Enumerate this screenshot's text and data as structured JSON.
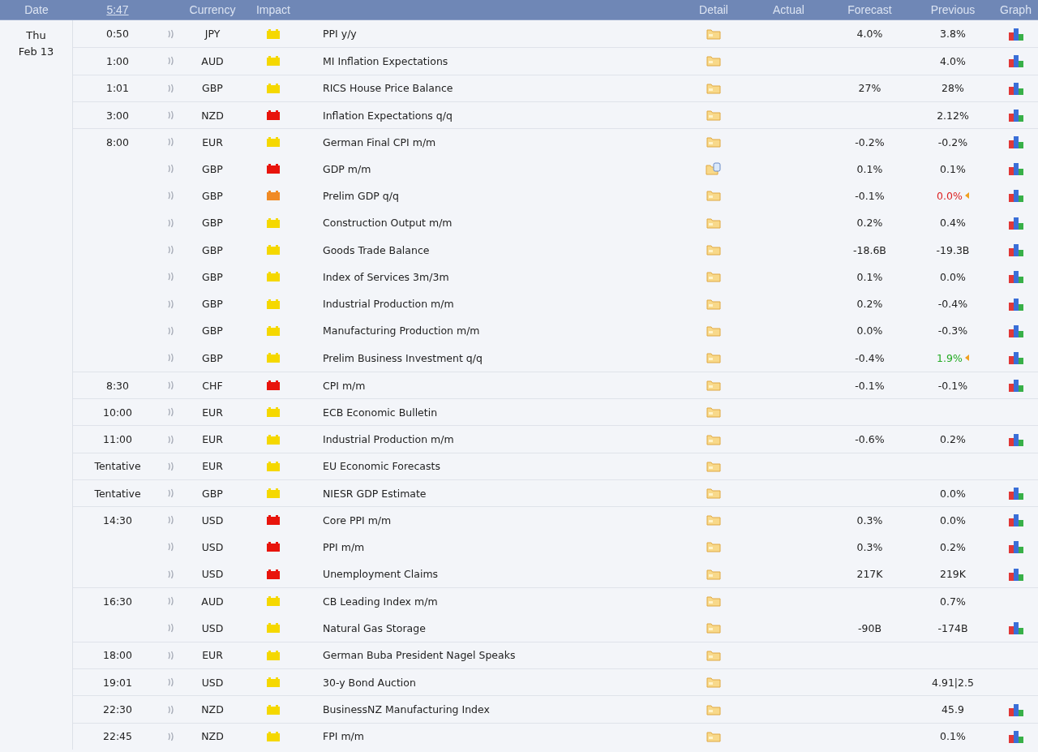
{
  "header": {
    "date": "Date",
    "clock": "5:47",
    "currency": "Currency",
    "impact": "Impact",
    "detail": "Detail",
    "actual": "Actual",
    "forecast": "Forecast",
    "previous": "Previous",
    "graph": "Graph"
  },
  "day": {
    "weekday": "Thu",
    "date": "Feb 13"
  },
  "events": [
    {
      "time": "0:50",
      "currency": "JPY",
      "color": "#f5d800",
      "event": "PPI y/y",
      "detail_updated": false,
      "forecast": "4.0%",
      "previous": "3.8%",
      "revised": false,
      "graph": true
    },
    {
      "time": "1:00",
      "currency": "AUD",
      "color": "#f5d800",
      "event": "MI Inflation Expectations",
      "detail_updated": false,
      "previous": "4.0%",
      "revised": false,
      "graph": true
    },
    {
      "time": "1:01",
      "currency": "GBP",
      "color": "#f5d800",
      "event": "RICS House Price Balance",
      "detail_updated": false,
      "forecast": "27%",
      "previous": "28%",
      "revised": false,
      "graph": true
    },
    {
      "time": "3:00",
      "currency": "NZD",
      "color": "#e8140c",
      "event": "Inflation Expectations q/q",
      "detail_updated": false,
      "previous": "2.12%",
      "revised": false,
      "graph": true
    },
    {
      "time": "8:00",
      "currency": "EUR",
      "color": "#f5d800",
      "event": "German Final CPI m/m",
      "detail_updated": false,
      "forecast": "-0.2%",
      "previous": "-0.2%",
      "revised": false,
      "graph": true
    },
    {
      "currency": "GBP",
      "color": "#e8140c",
      "event": "GDP m/m",
      "detail_updated": true,
      "forecast": "0.1%",
      "previous": "0.1%",
      "revised": false,
      "graph": true
    },
    {
      "currency": "GBP",
      "color": "#f08a24",
      "event": "Prelim GDP q/q",
      "detail_updated": false,
      "forecast": "-0.1%",
      "previous": "0.0%",
      "revised": true,
      "revised_better": false,
      "graph": true
    },
    {
      "currency": "GBP",
      "color": "#f5d800",
      "event": "Construction Output m/m",
      "detail_updated": false,
      "forecast": "0.2%",
      "previous": "0.4%",
      "revised": false,
      "graph": true
    },
    {
      "currency": "GBP",
      "color": "#f5d800",
      "event": "Goods Trade Balance",
      "detail_updated": false,
      "forecast": "-18.6B",
      "previous": "-19.3B",
      "revised": false,
      "graph": true
    },
    {
      "currency": "GBP",
      "color": "#f5d800",
      "event": "Index of Services 3m/3m",
      "detail_updated": false,
      "forecast": "0.1%",
      "previous": "0.0%",
      "revised": false,
      "graph": true
    },
    {
      "currency": "GBP",
      "color": "#f5d800",
      "event": "Industrial Production m/m",
      "detail_updated": false,
      "forecast": "0.2%",
      "previous": "-0.4%",
      "revised": false,
      "graph": true
    },
    {
      "currency": "GBP",
      "color": "#f5d800",
      "event": "Manufacturing Production m/m",
      "detail_updated": false,
      "forecast": "0.0%",
      "previous": "-0.3%",
      "revised": false,
      "graph": true
    },
    {
      "currency": "GBP",
      "color": "#f5d800",
      "event": "Prelim Business Investment q/q",
      "detail_updated": false,
      "forecast": "-0.4%",
      "previous": "1.9%",
      "revised": true,
      "revised_better": true,
      "graph": true
    },
    {
      "time": "8:30",
      "currency": "CHF",
      "color": "#e8140c",
      "event": "CPI m/m",
      "detail_updated": false,
      "forecast": "-0.1%",
      "previous": "-0.1%",
      "revised": false,
      "graph": true
    },
    {
      "time": "10:00",
      "currency": "EUR",
      "color": "#f5d800",
      "event": "ECB Economic Bulletin",
      "detail_updated": false,
      "graph": false
    },
    {
      "time": "11:00",
      "currency": "EUR",
      "color": "#f5d800",
      "event": "Industrial Production m/m",
      "detail_updated": false,
      "forecast": "-0.6%",
      "previous": "0.2%",
      "revised": false,
      "graph": true
    },
    {
      "time": "Tentative",
      "currency": "EUR",
      "color": "#f5d800",
      "event": "EU Economic Forecasts",
      "detail_updated": false,
      "graph": false
    },
    {
      "time": "Tentative",
      "currency": "GBP",
      "color": "#f5d800",
      "event": "NIESR GDP Estimate",
      "detail_updated": false,
      "previous": "0.0%",
      "revised": false,
      "graph": true
    },
    {
      "time": "14:30",
      "currency": "USD",
      "color": "#e8140c",
      "event": "Core PPI m/m",
      "detail_updated": false,
      "forecast": "0.3%",
      "previous": "0.0%",
      "revised": false,
      "graph": true
    },
    {
      "currency": "USD",
      "color": "#e8140c",
      "event": "PPI m/m",
      "detail_updated": false,
      "forecast": "0.3%",
      "previous": "0.2%",
      "revised": false,
      "graph": true
    },
    {
      "currency": "USD",
      "color": "#e8140c",
      "event": "Unemployment Claims",
      "detail_updated": false,
      "forecast": "217K",
      "previous": "219K",
      "revised": false,
      "graph": true
    },
    {
      "time": "16:30",
      "currency": "AUD",
      "color": "#f5d800",
      "event": "CB Leading Index m/m",
      "detail_updated": false,
      "previous": "0.7%",
      "revised": false,
      "graph": false
    },
    {
      "currency": "USD",
      "color": "#f5d800",
      "event": "Natural Gas Storage",
      "detail_updated": false,
      "forecast": "-90B",
      "previous": "-174B",
      "revised": false,
      "graph": true
    },
    {
      "time": "18:00",
      "currency": "EUR",
      "color": "#f5d800",
      "event": "German Buba President Nagel Speaks",
      "detail_updated": false,
      "graph": false
    },
    {
      "time": "19:01",
      "currency": "USD",
      "color": "#f5d800",
      "event": "30-y Bond Auction",
      "detail_updated": false,
      "previous": "4.91|2.5",
      "revised": false,
      "graph": false
    },
    {
      "time": "22:30",
      "currency": "NZD",
      "color": "#f5d800",
      "event": "BusinessNZ Manufacturing Index",
      "detail_updated": false,
      "previous": "45.9",
      "revised": false,
      "graph": true
    },
    {
      "time": "22:45",
      "currency": "NZD",
      "color": "#f5d800",
      "event": "FPI m/m",
      "detail_updated": false,
      "previous": "0.1%",
      "revised": false,
      "graph": true
    }
  ]
}
